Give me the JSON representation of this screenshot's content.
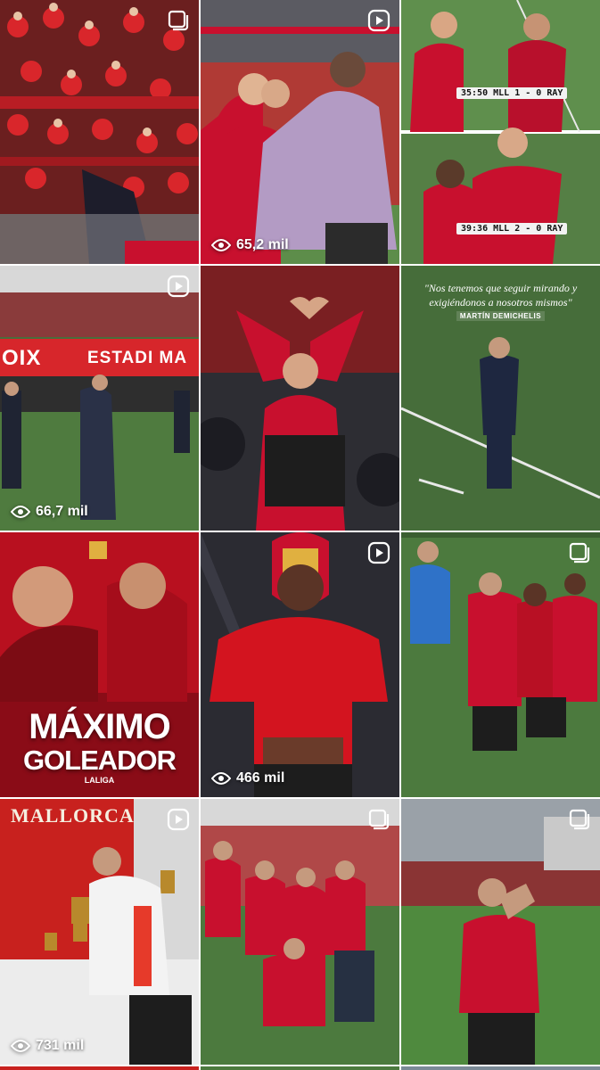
{
  "grid": {
    "tiles": [
      {
        "id": "t0",
        "media": "carousel",
        "views": ""
      },
      {
        "id": "t1",
        "media": "reel",
        "views": "65,2 mil"
      },
      {
        "id": "t2",
        "media": "post",
        "views": "",
        "scoreboards": [
          "35:50 MLL 1 - 0 RAY",
          "39:36 MLL 2 - 0 RAY"
        ]
      },
      {
        "id": "t3",
        "media": "reel",
        "views": "66,7 mil",
        "banner_left": "OIX",
        "banner_right": "ESTADI MA"
      },
      {
        "id": "t4",
        "media": "post",
        "views": ""
      },
      {
        "id": "t5",
        "media": "post",
        "views": "",
        "quote": "\"Nos tenemos que seguir mirando y exigiéndonos a nosotros mismos\"",
        "quote_author": "MARTÍN DEMICHELIS"
      },
      {
        "id": "t6",
        "media": "post",
        "views": "",
        "headline_1": "MÁXIMO",
        "headline_2": "GOLEADOR",
        "league": "LALIGA"
      },
      {
        "id": "t7",
        "media": "reel",
        "views": "466 mil"
      },
      {
        "id": "t8",
        "media": "carousel",
        "views": ""
      },
      {
        "id": "t9",
        "media": "reel",
        "views": "731 mil",
        "wall_sign": "MALLORCA"
      },
      {
        "id": "t10",
        "media": "carousel",
        "views": ""
      },
      {
        "id": "t11",
        "media": "carousel",
        "views": ""
      }
    ]
  },
  "icons": {
    "reel": "reel-icon",
    "carousel": "carousel-icon",
    "views": "eye-icon"
  },
  "colors": {
    "club_red": "#c8102e",
    "pitch_green": "#3f7a3a",
    "dark": "#1b1b1b"
  }
}
